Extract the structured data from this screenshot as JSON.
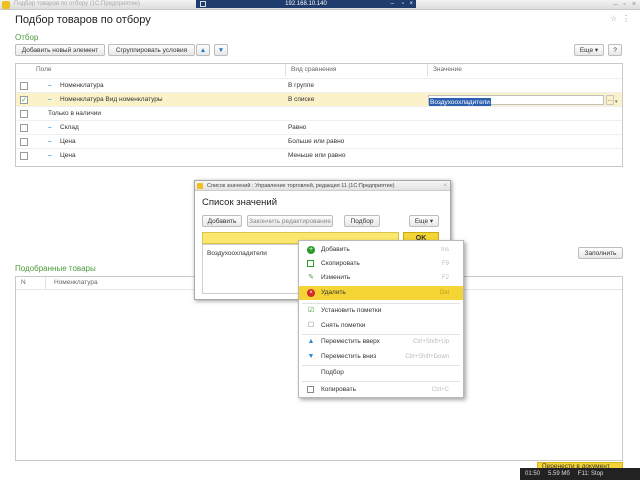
{
  "window": {
    "app_title": "Подбор товаров по отбору (1С:Предприятие)",
    "remote_host": "192.168.10.140"
  },
  "page": {
    "title": "Подбор товаров по отбору"
  },
  "filter": {
    "section_label": "Отбор",
    "add_button": "Добавить новый элемент",
    "group_button": "Сгруппировать условия",
    "up_icon": "arrow-up-icon",
    "down_icon": "arrow-down-icon",
    "more_button": "Еще",
    "help_button": "?",
    "columns": [
      "Поле",
      "Вид сравнения",
      "Значение"
    ],
    "rows": [
      {
        "checked": false,
        "field": "Номенклатура",
        "comparison": "В группе",
        "value": ""
      },
      {
        "checked": true,
        "field": "Номенклатура Вид номенклатуры",
        "comparison": "В списке",
        "value": "Воздухоохладители"
      },
      {
        "checked": false,
        "field": "Только в наличии",
        "comparison": "",
        "value": ""
      },
      {
        "checked": false,
        "field": "Склад",
        "comparison": "Равно",
        "value": ""
      },
      {
        "checked": false,
        "field": "Цена",
        "comparison": "Больше или равно",
        "value": ""
      },
      {
        "checked": false,
        "field": "Цена",
        "comparison": "Меньше или равно",
        "value": ""
      }
    ]
  },
  "fill_button": "Заполнить",
  "found": {
    "section_label": "Подобранные товары",
    "columns": [
      "N",
      "Номенклатура"
    ]
  },
  "bottom": {
    "action_button": "Перенести в документ"
  },
  "status": {
    "time": "01:50",
    "size": "5.59 Мб",
    "hint": "F11: Stop"
  },
  "dialog": {
    "title": "Список значений : Управление торговлей, редакция 11  (1С:Предприятие)",
    "heading": "Список значений",
    "add_button": "Добавить",
    "finish_button": "Закончить редактирование",
    "pick_button": "Подбор",
    "more_button": "Еще",
    "ok_button": "OK",
    "items": [
      "Воздухоохладители"
    ]
  },
  "context_menu": {
    "items": [
      {
        "label": "Добавить",
        "shortcut": "Ins",
        "icon": "add-icon",
        "color": "#2a9a2a"
      },
      {
        "label": "Скопировать",
        "shortcut": "F9",
        "icon": "copy-icon",
        "color": "#2a9a2a"
      },
      {
        "label": "Изменить",
        "shortcut": "F2",
        "icon": "edit-icon",
        "color": "#4a9a38"
      },
      {
        "label": "Удалить",
        "shortcut": "Del",
        "icon": "delete-icon",
        "color": "#d62828",
        "highlighted": true
      },
      {
        "label": "Установить пометки",
        "shortcut": "",
        "icon": "check-all-icon",
        "color": "#4a9a38"
      },
      {
        "label": "Снять пометки",
        "shortcut": "",
        "icon": "uncheck-all-icon",
        "color": "#7a7a7a"
      },
      {
        "label": "Переместить вверх",
        "shortcut": "Ctrl+Shift+Up",
        "icon": "move-up-icon",
        "color": "#2a8ad8"
      },
      {
        "label": "Переместить вниз",
        "shortcut": "Ctrl+Shift+Down",
        "icon": "move-down-icon",
        "color": "#2a8ad8"
      },
      {
        "label": "Подбор",
        "shortcut": "",
        "icon": "",
        "color": ""
      },
      {
        "label": "Копировать",
        "shortcut": "Ctrl+C",
        "icon": "copy-text-icon",
        "color": "#7a7a7a"
      }
    ]
  }
}
